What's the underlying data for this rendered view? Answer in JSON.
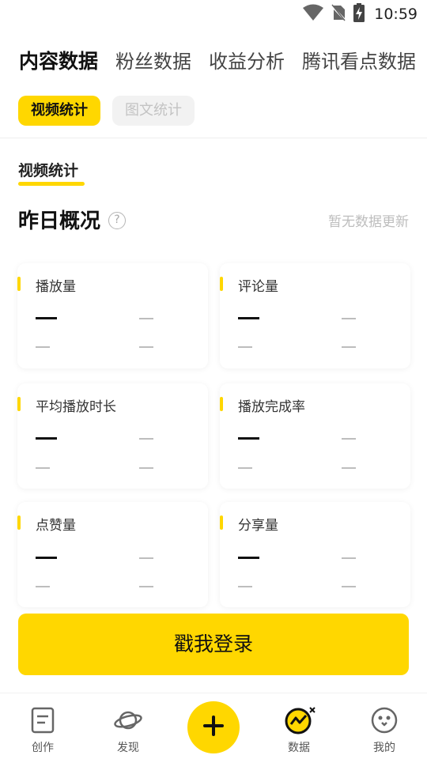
{
  "status_bar": {
    "time": "10:59",
    "icons": [
      "wifi-icon",
      "no-sim-icon",
      "battery-charging-icon"
    ]
  },
  "tabs": [
    {
      "label": "内容数据",
      "active": true
    },
    {
      "label": "粉丝数据",
      "active": false
    },
    {
      "label": "收益分析",
      "active": false
    },
    {
      "label": "腾讯看点数据",
      "active": false
    }
  ],
  "subtabs": [
    {
      "label": "视频统计",
      "active": true
    },
    {
      "label": "图文统计",
      "active": false
    }
  ],
  "section": {
    "label": "视频统计"
  },
  "overview": {
    "title": "昨日概况",
    "help_symbol": "?",
    "update_status": "暂无数据更新"
  },
  "metrics": [
    {
      "title": "播放量"
    },
    {
      "title": "评论量"
    },
    {
      "title": "平均播放时长"
    },
    {
      "title": "播放完成率"
    },
    {
      "title": "点赞量"
    },
    {
      "title": "分享量"
    }
  ],
  "login_button": {
    "label": "戳我登录"
  },
  "bottom_nav": [
    {
      "label": "创作",
      "icon": "document-icon"
    },
    {
      "label": "发现",
      "icon": "planet-icon"
    },
    {
      "label": "",
      "icon": "plus-icon"
    },
    {
      "label": "数据",
      "icon": "chart-icon"
    },
    {
      "label": "我的",
      "icon": "penguin-icon"
    }
  ],
  "colors": {
    "accent": "#FFD700",
    "text": "#111111",
    "muted": "#BDBDBD"
  }
}
